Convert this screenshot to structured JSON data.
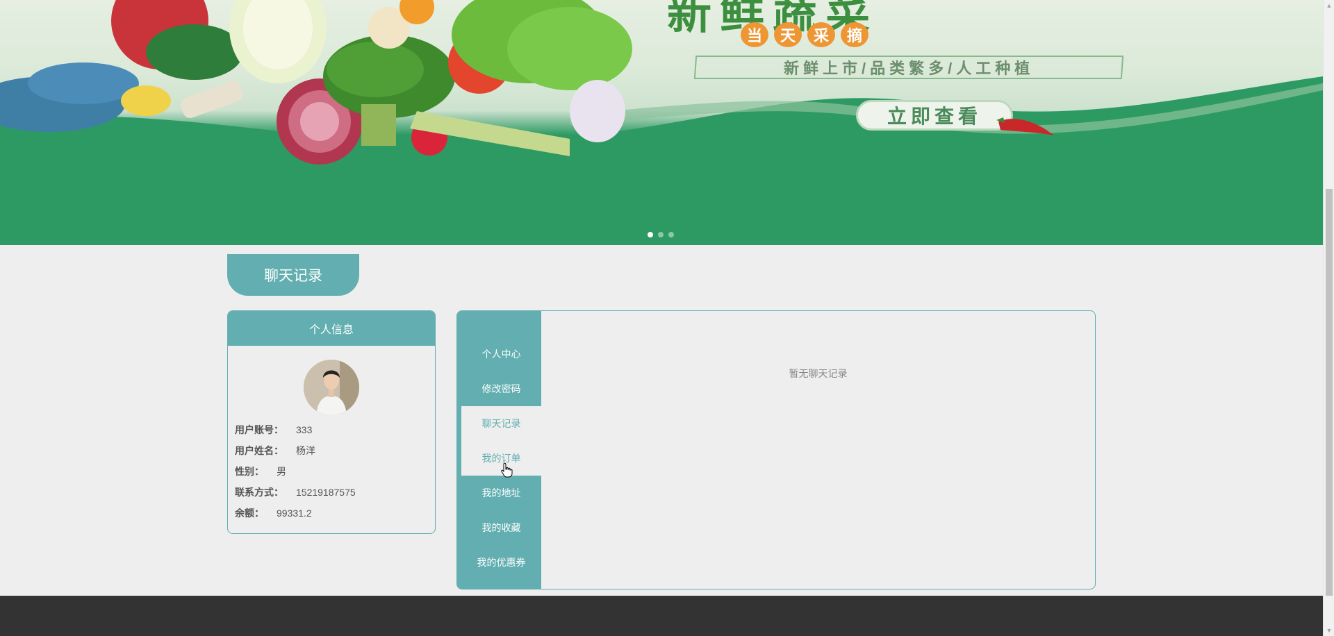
{
  "banner": {
    "headline": "新鲜蔬菜",
    "circles": [
      "当",
      "天",
      "采",
      "摘"
    ],
    "tagline": "新鲜上市/品类繁多/人工种植",
    "view_button": "立即查看",
    "dots_count": 3,
    "active_dot": 1
  },
  "page_title": "聊天记录",
  "profile": {
    "header": "个人信息",
    "fields": [
      {
        "label": "用户账号：",
        "value": "333"
      },
      {
        "label": "用户姓名：",
        "value": "杨洋"
      },
      {
        "label": "性别：",
        "value": "男"
      },
      {
        "label": "联系方式：",
        "value": "15219187575"
      },
      {
        "label": "余额：",
        "value": "99331.2"
      }
    ]
  },
  "side_nav": {
    "items": [
      {
        "label": "个人中心"
      },
      {
        "label": "修改密码"
      },
      {
        "label": "聊天记录"
      },
      {
        "label": "我的订单"
      },
      {
        "label": "我的地址"
      },
      {
        "label": "我的收藏"
      },
      {
        "label": "我的优惠券"
      }
    ],
    "active_index": 2,
    "hover_index": 3
  },
  "content": {
    "empty_text": "暂无聊天记录"
  },
  "colors": {
    "accent": "#62aeb0",
    "footer": "#333333",
    "background": "#eeeeee",
    "banner_green": "#2e9a63"
  }
}
